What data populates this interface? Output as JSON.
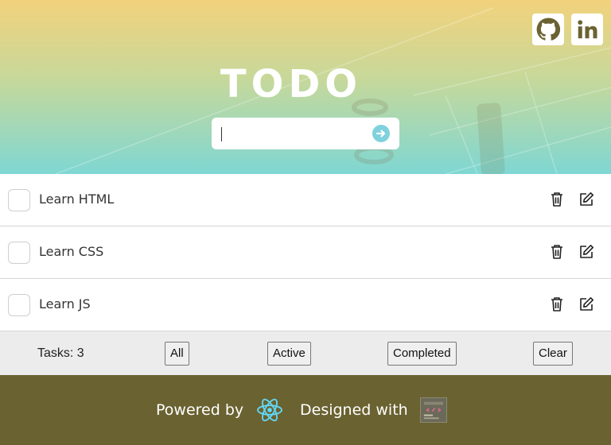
{
  "header": {
    "title": "TODO",
    "search": {
      "value": "",
      "placeholder": ""
    },
    "submit_icon": "arrow-right-circle-icon",
    "social": [
      "github-icon",
      "linkedin-icon"
    ],
    "colors": {
      "gradient_top": "#f2d27c",
      "gradient_bottom": "#7fd7d3",
      "submit_accent": "#7fd1dd"
    }
  },
  "tasks": [
    {
      "label": "Learn HTML",
      "completed": false
    },
    {
      "label": "Learn CSS",
      "completed": false
    },
    {
      "label": "Learn JS",
      "completed": false
    }
  ],
  "bar": {
    "count_label": "Tasks: 3",
    "filters": [
      "All",
      "Active",
      "Completed"
    ],
    "clear_label": "Clear"
  },
  "footer": {
    "powered_label": "Powered by",
    "designed_label": "Designed with",
    "background": "#6a6231",
    "icons": [
      "react-logo-icon",
      "designer-logo-icon"
    ]
  }
}
